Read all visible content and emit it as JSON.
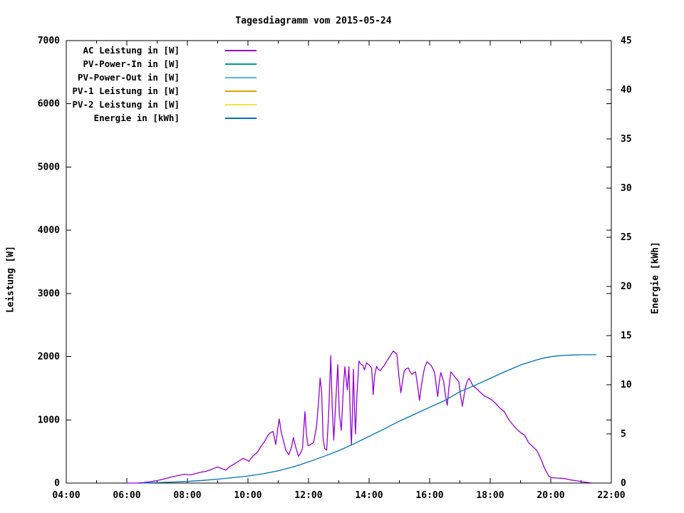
{
  "title": "Tagesdiagramm vom 2015-05-24",
  "chart_data": {
    "type": "line",
    "title": "Tagesdiagramm vom 2015-05-24",
    "background_color": "#ffffff",
    "grid": false,
    "axes": {
      "x": {
        "unit": "time-of-day",
        "range_minutes": [
          240,
          1320
        ],
        "major_tick_minutes": [
          240,
          360,
          480,
          600,
          720,
          840,
          960,
          1080,
          1200,
          1320
        ],
        "major_tick_labels": [
          "04:00",
          "06:00",
          "08:00",
          "10:00",
          "12:00",
          "14:00",
          "16:00",
          "18:00",
          "20:00",
          "22:00"
        ],
        "minor_tick_minutes": [
          300,
          420,
          540,
          660,
          780,
          900,
          1020,
          1140,
          1260
        ]
      },
      "y_left": {
        "label": "Leistung [W]",
        "range": [
          0,
          7000
        ],
        "tick_values": [
          0,
          1000,
          2000,
          3000,
          4000,
          5000,
          6000,
          7000
        ],
        "tick_labels": [
          "0",
          "1000",
          "2000",
          "3000",
          "4000",
          "5000",
          "6000",
          "7000"
        ]
      },
      "y_right": {
        "label": "Energie [kWh]",
        "range": [
          0,
          45
        ],
        "tick_values": [
          0,
          5,
          10,
          15,
          20,
          25,
          30,
          35,
          40,
          45
        ],
        "tick_labels": [
          "0",
          "5",
          "10",
          "15",
          "20",
          "25",
          "30",
          "35",
          "40",
          "45"
        ]
      }
    },
    "legend": {
      "position": "top-left-inside",
      "entries": [
        {
          "label": "AC Leistung in [W]",
          "color": "#9400d3"
        },
        {
          "label": "PV-Power-In in [W]",
          "color": "#009e73"
        },
        {
          "label": "PV-Power-Out in [W]",
          "color": "#56b4e9"
        },
        {
          "label": "PV-1 Leistung in [W]",
          "color": "#e69f00"
        },
        {
          "label": "PV-2 Leistung in [W]",
          "color": "#f0e442"
        },
        {
          "label": "Energie in [kWh]",
          "color": "#0072b2"
        }
      ]
    },
    "series": [
      {
        "name": "AC Leistung in [W]",
        "color": "#9400d3",
        "axis": "left",
        "points": [
          [
            360,
            0
          ],
          [
            378,
            0
          ],
          [
            392,
            8
          ],
          [
            406,
            20
          ],
          [
            420,
            40
          ],
          [
            434,
            65
          ],
          [
            448,
            95
          ],
          [
            462,
            120
          ],
          [
            474,
            140
          ],
          [
            486,
            130
          ],
          [
            496,
            150
          ],
          [
            506,
            170
          ],
          [
            516,
            185
          ],
          [
            526,
            210
          ],
          [
            533,
            235
          ],
          [
            540,
            255
          ],
          [
            548,
            230
          ],
          [
            556,
            205
          ],
          [
            563,
            255
          ],
          [
            572,
            300
          ],
          [
            582,
            350
          ],
          [
            590,
            390
          ],
          [
            597,
            368
          ],
          [
            602,
            345
          ],
          [
            610,
            430
          ],
          [
            618,
            480
          ],
          [
            626,
            580
          ],
          [
            633,
            660
          ],
          [
            640,
            760
          ],
          [
            645,
            800
          ],
          [
            650,
            815
          ],
          [
            655,
            610
          ],
          [
            659,
            860
          ],
          [
            662,
            1015
          ],
          [
            666,
            800
          ],
          [
            670,
            680
          ],
          [
            675,
            520
          ],
          [
            681,
            450
          ],
          [
            686,
            560
          ],
          [
            690,
            720
          ],
          [
            695,
            560
          ],
          [
            700,
            425
          ],
          [
            704,
            470
          ],
          [
            708,
            545
          ],
          [
            711,
            900
          ],
          [
            713,
            1130
          ],
          [
            716,
            760
          ],
          [
            719,
            590
          ],
          [
            724,
            610
          ],
          [
            730,
            640
          ],
          [
            736,
            900
          ],
          [
            740,
            1300
          ],
          [
            743,
            1660
          ],
          [
            746,
            1450
          ],
          [
            749,
            700
          ],
          [
            752,
            550
          ],
          [
            756,
            520
          ],
          [
            760,
            1100
          ],
          [
            764,
            2015
          ],
          [
            767,
            1200
          ],
          [
            770,
            680
          ],
          [
            774,
            1300
          ],
          [
            778,
            1875
          ],
          [
            781,
            1100
          ],
          [
            785,
            835
          ],
          [
            789,
            1500
          ],
          [
            792,
            1840
          ],
          [
            795,
            1620
          ],
          [
            797,
            1475
          ],
          [
            800,
            1840
          ],
          [
            803,
            1000
          ],
          [
            805,
            600
          ],
          [
            807,
            1100
          ],
          [
            809,
            1800
          ],
          [
            811,
            1200
          ],
          [
            813,
            775
          ],
          [
            816,
            1400
          ],
          [
            820,
            1930
          ],
          [
            824,
            1880
          ],
          [
            828,
            1860
          ],
          [
            831,
            1790
          ],
          [
            835,
            1900
          ],
          [
            840,
            1870
          ],
          [
            845,
            1820
          ],
          [
            847,
            1560
          ],
          [
            848,
            1400
          ],
          [
            851,
            1700
          ],
          [
            855,
            1850
          ],
          [
            858,
            1800
          ],
          [
            862,
            1780
          ],
          [
            866,
            1820
          ],
          [
            870,
            1860
          ],
          [
            875,
            1930
          ],
          [
            880,
            1990
          ],
          [
            884,
            2040
          ],
          [
            888,
            2090
          ],
          [
            892,
            2060
          ],
          [
            895,
            2040
          ],
          [
            899,
            1700
          ],
          [
            903,
            1430
          ],
          [
            907,
            1650
          ],
          [
            910,
            1780
          ],
          [
            914,
            1810
          ],
          [
            918,
            1820
          ],
          [
            921,
            1760
          ],
          [
            925,
            1720
          ],
          [
            929,
            1750
          ],
          [
            932,
            1760
          ],
          [
            936,
            1550
          ],
          [
            940,
            1310
          ],
          [
            944,
            1560
          ],
          [
            948,
            1750
          ],
          [
            951,
            1850
          ],
          [
            955,
            1920
          ],
          [
            959,
            1890
          ],
          [
            963,
            1860
          ],
          [
            967,
            1800
          ],
          [
            970,
            1740
          ],
          [
            973,
            1550
          ],
          [
            976,
            1370
          ],
          [
            979,
            1600
          ],
          [
            982,
            1750
          ],
          [
            985,
            1680
          ],
          [
            988,
            1600
          ],
          [
            991,
            1400
          ],
          [
            995,
            1230
          ],
          [
            998,
            1500
          ],
          [
            1002,
            1760
          ],
          [
            1006,
            1720
          ],
          [
            1010,
            1680
          ],
          [
            1014,
            1640
          ],
          [
            1018,
            1600
          ],
          [
            1021,
            1400
          ],
          [
            1025,
            1215
          ],
          [
            1028,
            1380
          ],
          [
            1032,
            1550
          ],
          [
            1035,
            1620
          ],
          [
            1038,
            1660
          ],
          [
            1042,
            1600
          ],
          [
            1045,
            1550
          ],
          [
            1049,
            1520
          ],
          [
            1052,
            1500
          ],
          [
            1056,
            1470
          ],
          [
            1060,
            1440
          ],
          [
            1064,
            1410
          ],
          [
            1068,
            1380
          ],
          [
            1072,
            1365
          ],
          [
            1076,
            1350
          ],
          [
            1080,
            1330
          ],
          [
            1084,
            1310
          ],
          [
            1088,
            1280
          ],
          [
            1092,
            1250
          ],
          [
            1096,
            1215
          ],
          [
            1100,
            1180
          ],
          [
            1104,
            1155
          ],
          [
            1108,
            1130
          ],
          [
            1112,
            1070
          ],
          [
            1116,
            1015
          ],
          [
            1120,
            970
          ],
          [
            1124,
            930
          ],
          [
            1128,
            895
          ],
          [
            1132,
            860
          ],
          [
            1136,
            830
          ],
          [
            1140,
            800
          ],
          [
            1144,
            780
          ],
          [
            1148,
            760
          ],
          [
            1152,
            700
          ],
          [
            1156,
            640
          ],
          [
            1160,
            610
          ],
          [
            1164,
            580
          ],
          [
            1168,
            550
          ],
          [
            1172,
            520
          ],
          [
            1176,
            460
          ],
          [
            1180,
            390
          ],
          [
            1184,
            310
          ],
          [
            1188,
            230
          ],
          [
            1192,
            170
          ],
          [
            1196,
            110
          ],
          [
            1200,
            90
          ],
          [
            1204,
            85
          ],
          [
            1210,
            80
          ],
          [
            1216,
            78
          ],
          [
            1222,
            75
          ],
          [
            1228,
            70
          ],
          [
            1234,
            60
          ],
          [
            1240,
            50
          ],
          [
            1246,
            42
          ],
          [
            1252,
            35
          ],
          [
            1258,
            28
          ],
          [
            1264,
            18
          ],
          [
            1270,
            12
          ],
          [
            1276,
            7
          ],
          [
            1280,
            4
          ]
        ]
      },
      {
        "name": "PV-Power-In in [W]",
        "color": "#009e73",
        "axis": "left",
        "points": []
      },
      {
        "name": "PV-Power-Out in [W]",
        "color": "#56b4e9",
        "axis": "left",
        "points": []
      },
      {
        "name": "PV-1 Leistung in [W]",
        "color": "#e69f00",
        "axis": "left",
        "points": []
      },
      {
        "name": "PV-2 Leistung in [W]",
        "color": "#f0e442",
        "axis": "left",
        "points": []
      },
      {
        "name": "Energie in [kWh]",
        "color": "#0072b2",
        "axis": "right",
        "points": [
          [
            390,
            0
          ],
          [
            420,
            0.05
          ],
          [
            450,
            0.1
          ],
          [
            480,
            0.17
          ],
          [
            510,
            0.27
          ],
          [
            540,
            0.4
          ],
          [
            570,
            0.55
          ],
          [
            600,
            0.72
          ],
          [
            630,
            0.95
          ],
          [
            660,
            1.25
          ],
          [
            690,
            1.65
          ],
          [
            720,
            2.15
          ],
          [
            750,
            2.7
          ],
          [
            780,
            3.3
          ],
          [
            810,
            4.0
          ],
          [
            840,
            4.75
          ],
          [
            870,
            5.5
          ],
          [
            900,
            6.3
          ],
          [
            930,
            7.0
          ],
          [
            960,
            7.7
          ],
          [
            990,
            8.4
          ],
          [
            1020,
            9.3
          ],
          [
            1050,
            9.95
          ],
          [
            1080,
            10.65
          ],
          [
            1110,
            11.35
          ],
          [
            1140,
            12.0
          ],
          [
            1170,
            12.5
          ],
          [
            1185,
            12.7
          ],
          [
            1200,
            12.85
          ],
          [
            1215,
            12.95
          ],
          [
            1230,
            13.0
          ],
          [
            1245,
            13.03
          ],
          [
            1260,
            13.05
          ],
          [
            1290,
            13.05
          ]
        ]
      }
    ]
  }
}
